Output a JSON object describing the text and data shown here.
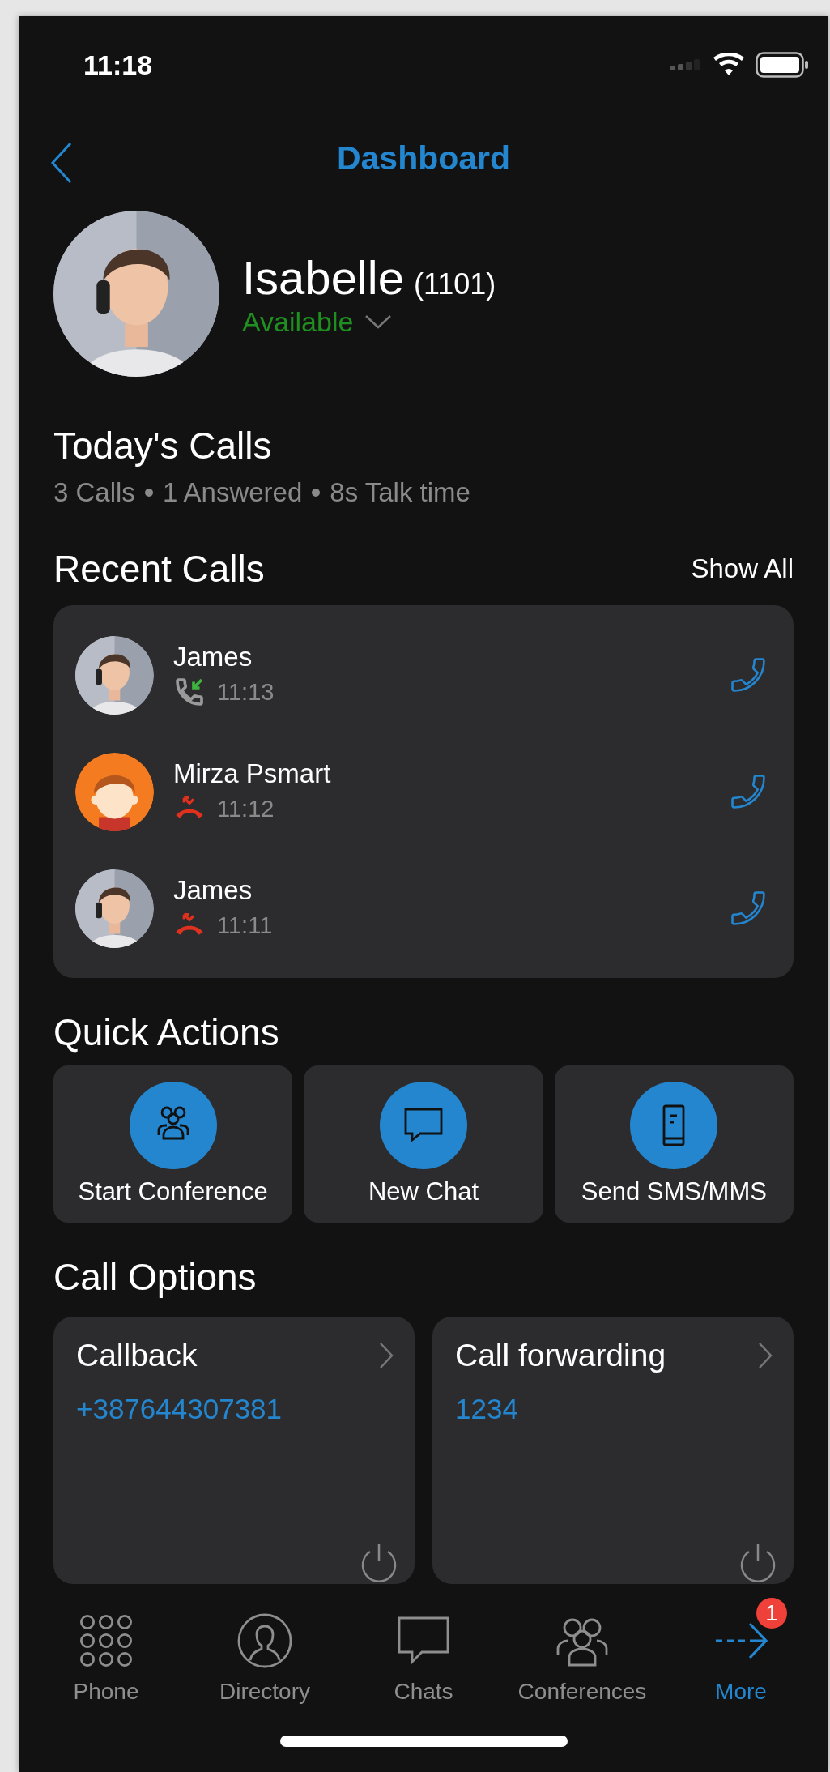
{
  "status_bar": {
    "time": "11:18"
  },
  "header": {
    "title": "Dashboard"
  },
  "profile": {
    "name": "Isabelle",
    "extension": "(1101)",
    "status": "Available"
  },
  "todays_calls": {
    "title": "Today's Calls",
    "summary": [
      "3 Calls",
      "1 Answered",
      "8s Talk time"
    ]
  },
  "recent_calls": {
    "title": "Recent Calls",
    "show_all": "Show All",
    "calls": [
      {
        "name": "James",
        "time": "11:13",
        "kind": "incoming"
      },
      {
        "name": "Mirza Psmart",
        "time": "11:12",
        "kind": "missed",
        "avatar": {
          "kind": "cartoon"
        }
      },
      {
        "name": "James",
        "time": "11:11",
        "kind": "missed"
      }
    ]
  },
  "quick_actions": {
    "title": "Quick Actions",
    "items": [
      {
        "label": "Start Conference",
        "kind": "conference"
      },
      {
        "label": "New Chat",
        "kind": "chat"
      },
      {
        "label": "Send SMS/MMS",
        "kind": "sms"
      }
    ]
  },
  "call_options": {
    "title": "Call Options",
    "items": [
      {
        "title": "Callback",
        "value": "+387644307381"
      },
      {
        "title": "Call forwarding",
        "value": "1234"
      }
    ]
  },
  "tab_bar": {
    "items": [
      {
        "label": "Phone",
        "kind": "phone",
        "selected": false
      },
      {
        "label": "Directory",
        "kind": "directory",
        "selected": false
      },
      {
        "label": "Chats",
        "kind": "chats",
        "selected": false
      },
      {
        "label": "Conferences",
        "kind": "conferences",
        "selected": false
      },
      {
        "label": "More",
        "kind": "more",
        "selected": true,
        "badge": "1"
      }
    ]
  }
}
